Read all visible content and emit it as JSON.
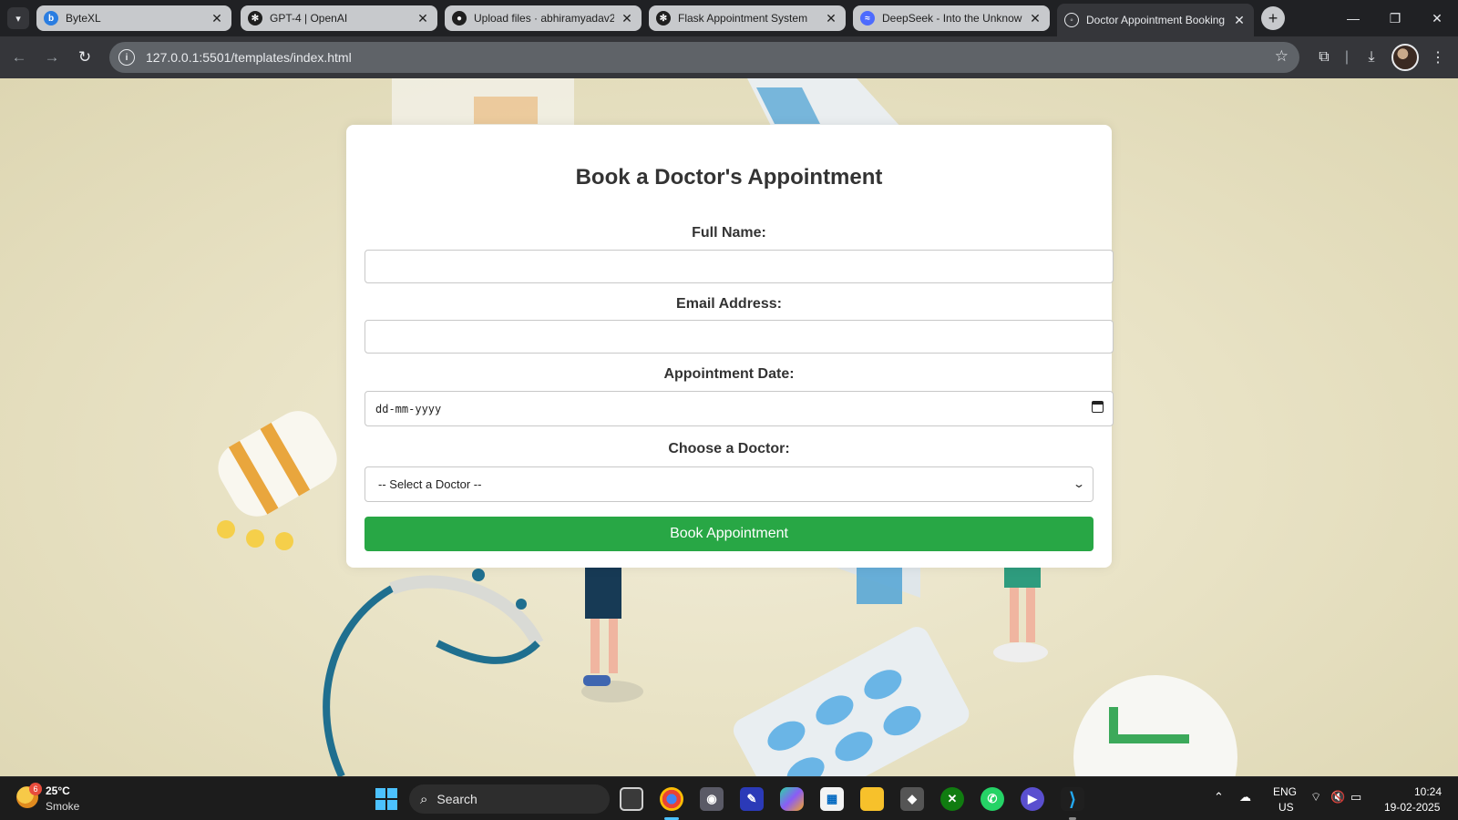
{
  "browser": {
    "tabs": [
      {
        "title": "ByteXL",
        "favicon": "bytexl-icon"
      },
      {
        "title": "GPT-4 | OpenAI",
        "favicon": "openai-icon"
      },
      {
        "title": "Upload files · abhiramyadav2",
        "favicon": "github-icon"
      },
      {
        "title": "Flask Appointment System",
        "favicon": "openai-icon"
      },
      {
        "title": "DeepSeek - Into the Unknown",
        "favicon": "deepseek-icon"
      },
      {
        "title": "Doctor Appointment Booking",
        "favicon": "globe-icon"
      }
    ],
    "active_tab_index": 5,
    "url": "127.0.0.1:5501/templates/index.html"
  },
  "page": {
    "heading": "Book a Doctor's Appointment",
    "full_name": {
      "label": "Full Name:",
      "value": ""
    },
    "email": {
      "label": "Email Address:",
      "value": ""
    },
    "date": {
      "label": "Appointment Date:",
      "placeholder": "dd-mm-yyyy"
    },
    "doctor": {
      "label": "Choose a Doctor:",
      "selected": "-- Select a Doctor --"
    },
    "submit_label": "Book Appointment",
    "accent_color": "#28a745"
  },
  "taskbar": {
    "weather": {
      "temp": "25°C",
      "condition": "Smoke",
      "badge": "6"
    },
    "search_label": "Search",
    "language": {
      "line1": "ENG",
      "line2": "US"
    },
    "clock": {
      "time": "10:24",
      "date": "19-02-2025"
    }
  }
}
